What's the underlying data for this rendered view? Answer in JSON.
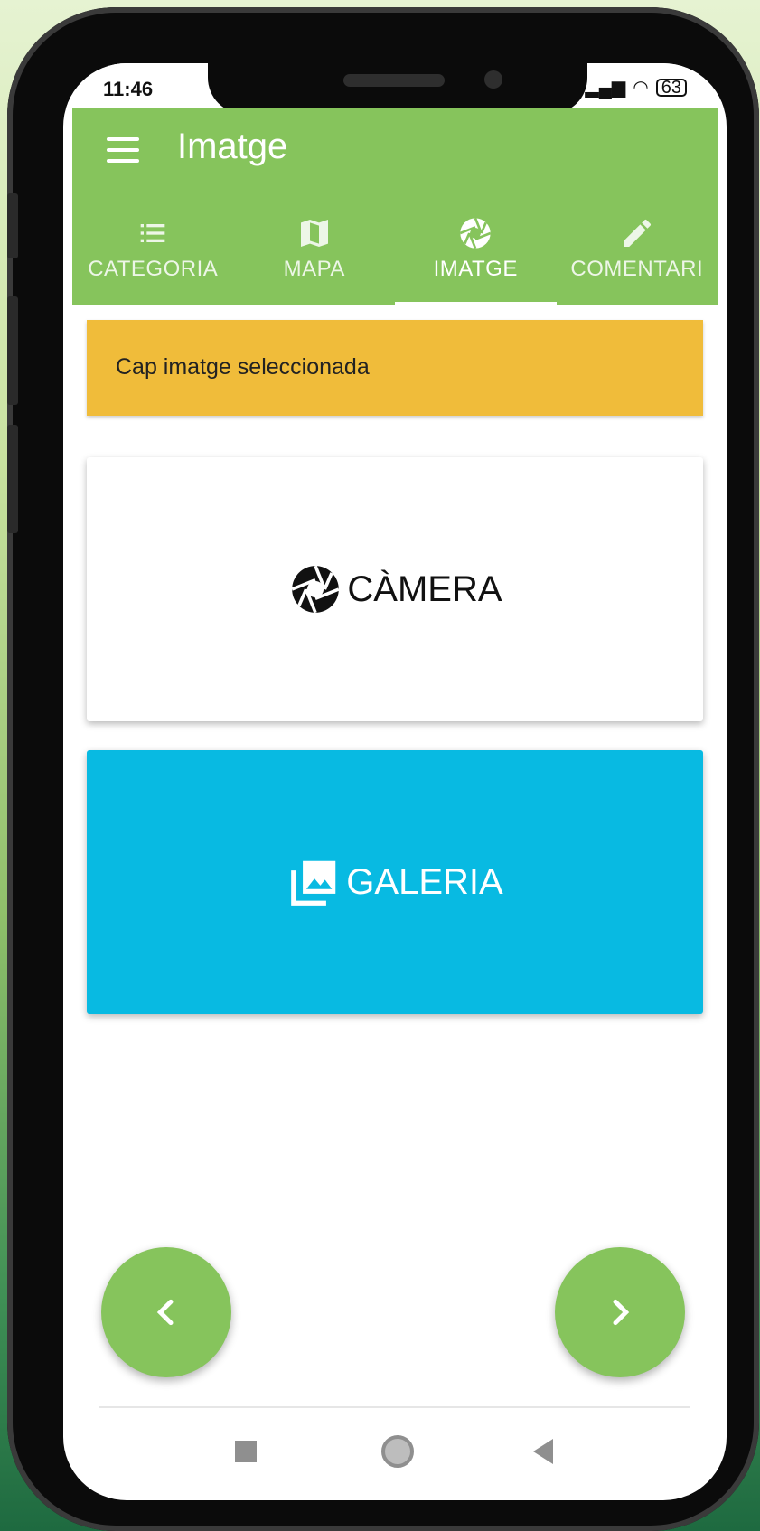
{
  "status_bar": {
    "time": "11:46",
    "battery": "63"
  },
  "app_bar": {
    "title": "Imatge"
  },
  "tabs": [
    {
      "label": "CATEGORIA",
      "icon": "list-icon"
    },
    {
      "label": "MAPA",
      "icon": "map-icon"
    },
    {
      "label": "IMATGE",
      "icon": "camera-aperture-icon",
      "active": true
    },
    {
      "label": "COMENTARI",
      "icon": "pencil-icon"
    }
  ],
  "alert": {
    "text": "Cap imatge seleccionada",
    "color": "#f0bc3a"
  },
  "camera_button": {
    "label": "CÀMERA",
    "icon": "camera-aperture-icon"
  },
  "gallery_button": {
    "label": "GALERIA",
    "icon": "photo-library-icon",
    "color": "#08bae2"
  },
  "navigation": {
    "prev_icon": "chevron-left-icon",
    "next_icon": "chevron-right-icon"
  },
  "colors": {
    "primary": "#86c45c",
    "warning": "#f0bc3a",
    "accent": "#08bae2"
  }
}
